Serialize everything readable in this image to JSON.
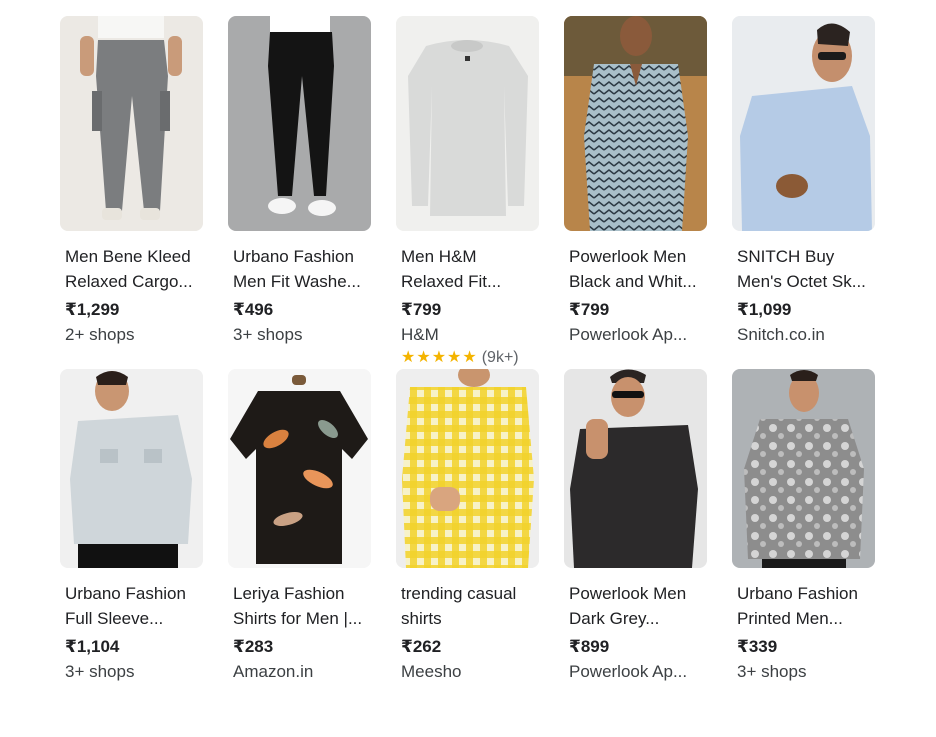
{
  "products": [
    {
      "title1": "Men Bene Kleed",
      "title2": "Relaxed Cargo...",
      "price": "₹1,299",
      "seller": "2+ shops",
      "image": "grey-cargo-pants"
    },
    {
      "title1": "Urbano Fashion",
      "title2": "Men Fit Washe...",
      "price": "₹496",
      "seller": "3+ shops",
      "image": "black-jeans"
    },
    {
      "title1": "Men H&M",
      "title2": "Relaxed Fit...",
      "price": "₹799",
      "seller": "H&M",
      "image": "grey-sweatshirt",
      "rating": {
        "stars": "★★★★★",
        "count": "(9k+)"
      }
    },
    {
      "title1": "Powerlook Men",
      "title2": "Black and Whit...",
      "price": "₹799",
      "seller": "Powerlook Ap...",
      "image": "patterned-shirt"
    },
    {
      "title1": "SNITCH Buy",
      "title2": "Men's Octet Sk...",
      "price": "₹1,099",
      "seller": "Snitch.co.in",
      "image": "light-blue-shirt"
    },
    {
      "title1": "Urbano Fashion",
      "title2": "Full Sleeve...",
      "price": "₹1,104",
      "seller": "3+ shops",
      "image": "denim-jacket"
    },
    {
      "title1": "Leriya Fashion",
      "title2": "Shirts for Men |...",
      "price": "₹283",
      "seller": "Amazon.in",
      "image": "floral-shirt"
    },
    {
      "title1": "trending casual",
      "title2": "shirts",
      "price": "₹262",
      "seller": "Meesho",
      "image": "yellow-check-shirt"
    },
    {
      "title1": "Powerlook Men",
      "title2": "Dark Grey...",
      "price": "₹899",
      "seller": "Powerlook Ap...",
      "image": "dark-shirt"
    },
    {
      "title1": "Urbano Fashion",
      "title2": "Printed Men...",
      "price": "₹339",
      "seller": "3+ shops",
      "image": "printed-tshirt"
    }
  ],
  "colors": {
    "star": "#f4b400",
    "text": "#202124",
    "muted": "#3c4043"
  }
}
